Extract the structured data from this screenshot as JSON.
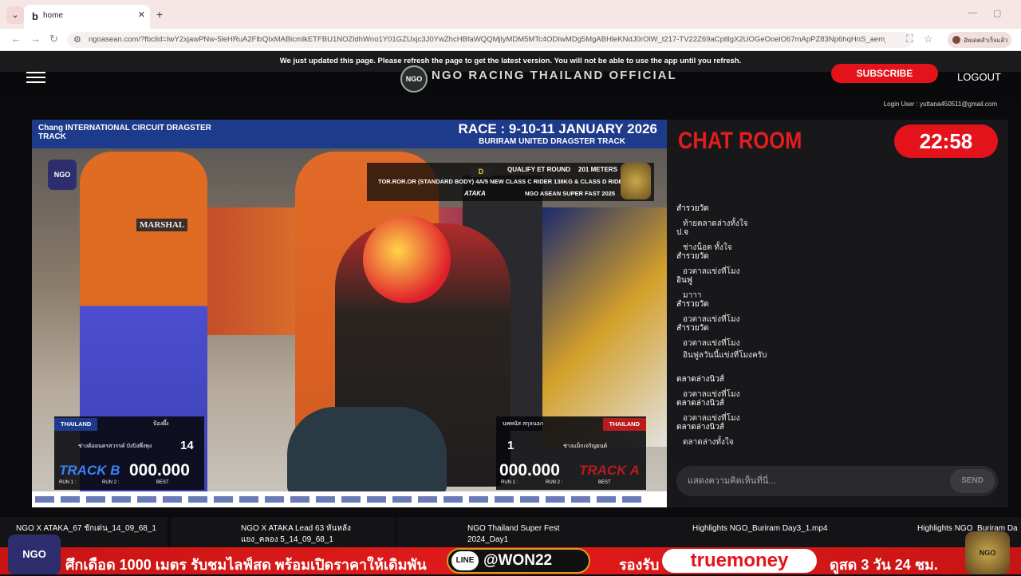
{
  "browser": {
    "tab_title": "home",
    "tab_favicon": "b",
    "url": "ngoasean.com/?fbclid=IwY2xjawPNw-5leHRuA2FlbQIxMABicmlkETFBU1NOZldhWno1Y01GZUxjc3J0YwZhcHBfaWQQMjlyMDM5MTc4ODIwMDg5MgABHleKNdJ0rOlW_t217-TV22Z69aCptllgX2UOGeOoelO67mApPZ83Np6hqHnS_aem_fwE7TlcNC...",
    "profile_label": "อัพเดตสำเร็จแล้ว"
  },
  "banner": {
    "text": "We just updated this page. Please refresh the page to get the latest version. You will not be able to use the app until you refresh."
  },
  "header": {
    "logo_text": "NGO",
    "title": "NGO RACING THAILAND OFFICIAL",
    "subscribe": "SUBSCRIBE",
    "logout": "LOGOUT",
    "login_user": "Login User : yuttana450511@gmail.com"
  },
  "video": {
    "sponsor": "Chang INTERNATIONAL CIRCUIT  DRAGSTER TRACK",
    "race_title": "RACE : 9-10-11 JANUARY 2026",
    "track_title": "BURIRAM UNITED DRAGSTER TRACK",
    "ngo_badge": "NGO",
    "class_code": "D",
    "round": "QUALIFY ET ROUND",
    "meters": "201 METERS",
    "class_desc": "TOR.ROR.OR (STANDARD BODY) 4A/5 NEW CLASS C RIDER 138KG & CLASS D RIDER 137K",
    "series": "NGO ASEAN SUPER FAST 2025",
    "ataka": "ATAKA",
    "marshal": "MARSHAL",
    "left": {
      "country": "THAILAND",
      "name": "ป้องผึ้ง",
      "team": "ช่างต้อยนครสวรรค์ บังปิงพึ่งพุง",
      "number": "14",
      "track": "TRACK B",
      "time": "000.000",
      "run1": "RUN 1 :",
      "run2": "RUN 2 :",
      "best": "BEST"
    },
    "right": {
      "country": "THAILAND",
      "name": "นพพนัส สกุลนอก",
      "team": "ช่างแม็กเจริญยนต์",
      "number": "1",
      "track": "TRACK A",
      "time": "000.000",
      "run1": "RUN 1 :",
      "run2": "RUN 2 :",
      "best": "BEST"
    }
  },
  "chat": {
    "title": "CHAT ROOM",
    "timer": "22:58",
    "messages": [
      {
        "user": "สำรวยวัด",
        "text": "ท้ายตลาดล่างทั้งใจ"
      },
      {
        "user": "ป.จ",
        "text": "ช่างน็อต ทั้งใจ"
      },
      {
        "user": "สำรวยวัด",
        "text": "อวตาลแข่งที่โมง"
      },
      {
        "user": "อินฟู",
        "text": "มาาา"
      },
      {
        "user": "สำรวยวัด",
        "text": "อวตาลแข่งที่โมง"
      },
      {
        "user": "สำรวยวัด",
        "text": "อวตาลแข่งที่โมง"
      },
      {
        "user": "",
        "text": "อินฟูลวันนี้แข่งที่โมงครับ"
      },
      {
        "user": "ตลาดล่างนิวส์",
        "text": "อวตาลแข่งที่โมง"
      },
      {
        "user": "ตลาดล่างนิวส์",
        "text": "อวตาลแข่งที่โมง"
      },
      {
        "user": "ตลาดล่างนิวส์",
        "text": "ตลาดล่างทั้งใจ"
      }
    ],
    "input_placeholder": "แสดงความคิดเห็นที่นี่...",
    "send": "SEND"
  },
  "video_list": [
    {
      "title": "NGO X ATAKA_67 ชักเด่น_14_09_68_1"
    },
    {
      "title": "NGO X ATAKA Lead 63 หันหลัง\nแยง_คลอง 5_14_09_68_1"
    },
    {
      "title": "NGO Thailand Super Fest\n2024_Day1"
    },
    {
      "title": "Highlights NGO_Buriram Day3_1.mp4"
    },
    {
      "title": "Highlights NGO_Buriram Da"
    }
  ],
  "ad": {
    "logo": "NGO",
    "text": "ศึกเดือด 1000 เมตร รับชมไลฟ์สด พร้อมเปิดราคาให้เดิมพัน",
    "line_icon": "LINE",
    "line_id": "@WON22",
    "accept": "รองรับ",
    "truemoney": "truemoney",
    "days": "ดูสด 3 วัน 24 ชม.",
    "seal": "NGO"
  },
  "icons": {
    "clock": "alarm-clock-icon",
    "star": "star-icon",
    "translate": "translate-icon"
  },
  "colors": {
    "accent_red": "#e4131b",
    "chat_title": "#e11d1d",
    "race_bar": "#1e3a8a"
  }
}
